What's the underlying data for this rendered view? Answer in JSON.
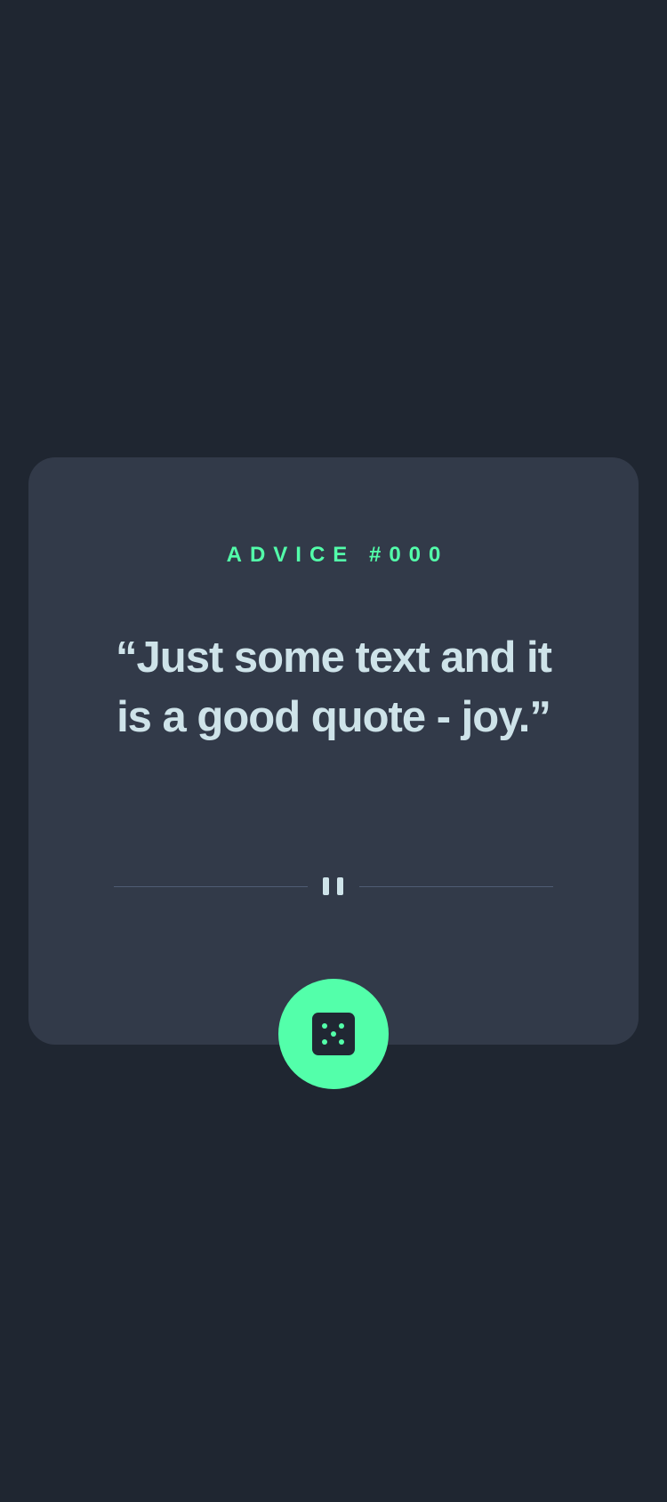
{
  "advice": {
    "label": "ADVICE #000",
    "quote": "“Just some text and it is a good quote - joy.”"
  },
  "divider": {
    "icon": "pause-icon"
  },
  "button": {
    "icon": "dice-icon"
  },
  "colors": {
    "background": "#1f2631",
    "card": "#323a49",
    "accent": "#53ffaa",
    "text": "#cee3e9",
    "divider_line": "#4f5d74"
  }
}
